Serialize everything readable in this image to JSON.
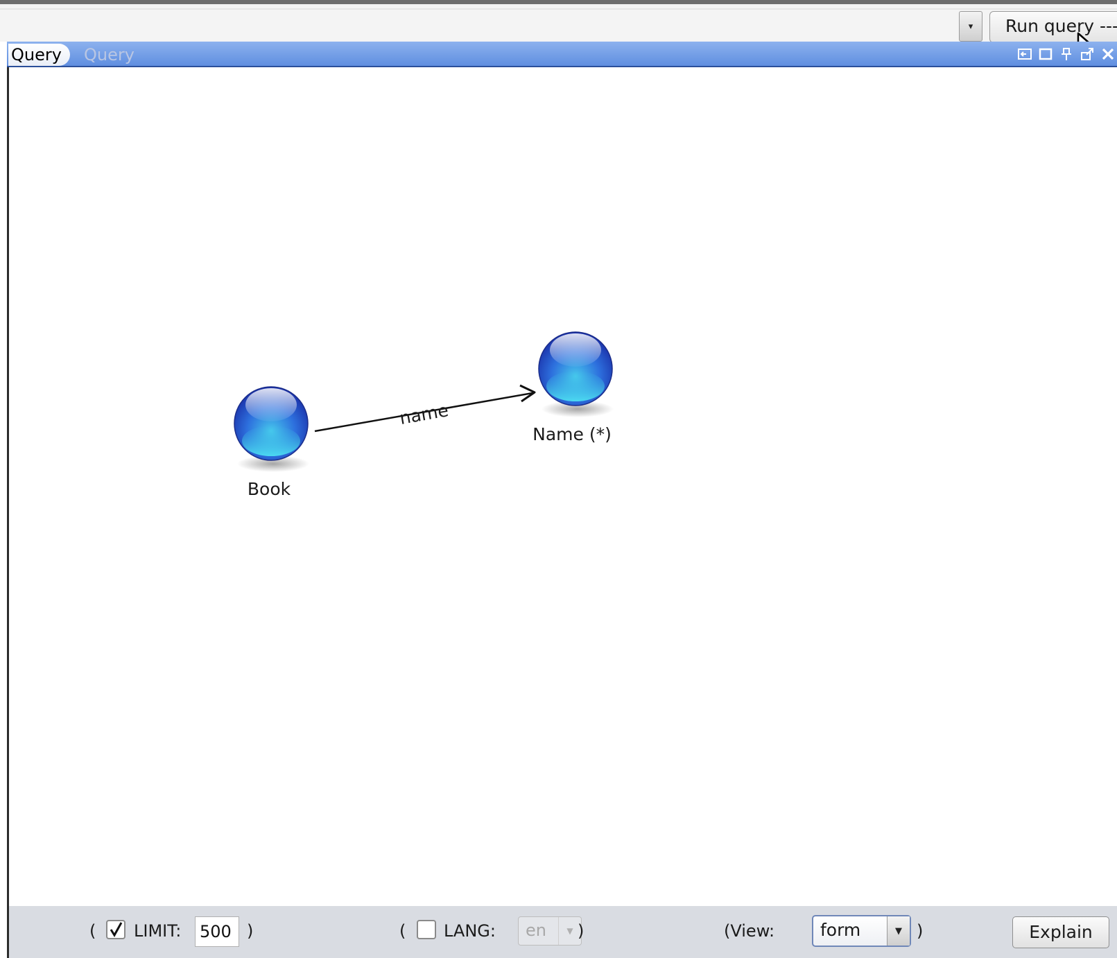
{
  "toolbar": {
    "run_query_label": "Run query ---",
    "combo_arrow": "▾"
  },
  "tabs": {
    "active_label": "Query",
    "inactive_label": "Query"
  },
  "graph": {
    "nodes": [
      {
        "id": "book",
        "label": "Book"
      },
      {
        "id": "name",
        "label": "Name (*)"
      }
    ],
    "edges": [
      {
        "from": "book",
        "to": "name",
        "label": "name"
      }
    ]
  },
  "bottom": {
    "limit": {
      "paren_open": "(",
      "checked": true,
      "label": "LIMIT:",
      "value": "500",
      "paren_close": ")"
    },
    "lang": {
      "paren_open": "(",
      "checked": false,
      "label": "LANG:",
      "value": "en",
      "paren_close": ")"
    },
    "view": {
      "label": "(View:",
      "value": "form",
      "paren_close": ")"
    },
    "explain_label": "Explain"
  },
  "colors": {
    "tab_blue": "#5f8ee0",
    "node_blue": "#2a55d6",
    "node_cyan": "#3fd0e8"
  },
  "icons": [
    "chevron-down-icon",
    "minimize-icon",
    "maximize-icon",
    "pin-icon",
    "float-icon",
    "close-icon",
    "checkbox-checked-icon",
    "mouse-cursor-icon"
  ]
}
